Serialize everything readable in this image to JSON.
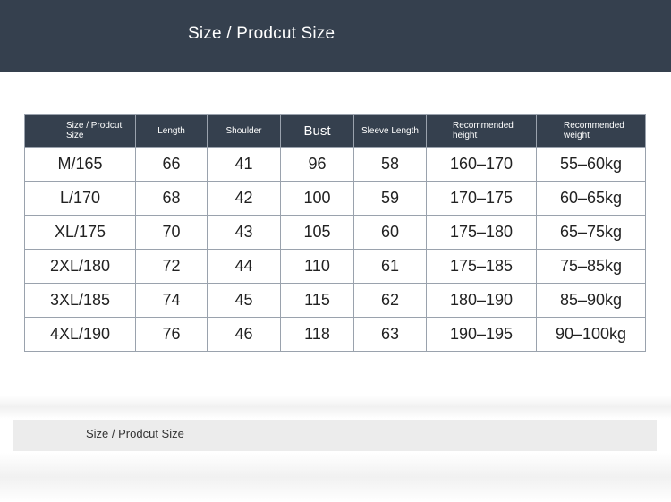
{
  "header": {
    "title": "Size / Prodcut Size"
  },
  "table": {
    "columns": [
      "Size / Prodcut Size",
      "Length",
      "Shoulder",
      "Bust",
      "Sleeve Length",
      "Recommended height",
      "Recommended weight"
    ],
    "rows": [
      [
        "M/165",
        "66",
        "41",
        "96",
        "58",
        "160–170",
        "55–60kg"
      ],
      [
        "L/170",
        "68",
        "42",
        "100",
        "59",
        "170–175",
        "60–65kg"
      ],
      [
        "XL/175",
        "70",
        "43",
        "105",
        "60",
        "175–180",
        "65–75kg"
      ],
      [
        "2XL/180",
        "72",
        "44",
        "110",
        "61",
        "175–185",
        "75–85kg"
      ],
      [
        "3XL/185",
        "74",
        "45",
        "115",
        "62",
        "180–190",
        "85–90kg"
      ],
      [
        "4XL/190",
        "76",
        "46",
        "118",
        "63",
        "190–195",
        "90–100kg"
      ]
    ]
  },
  "footer": {
    "label": "Size / Prodcut Size"
  },
  "colors": {
    "header_bg": "#35404e",
    "header_text": "#ffffff",
    "border": "#9aa2ad",
    "footer_bg": "#ececec"
  }
}
